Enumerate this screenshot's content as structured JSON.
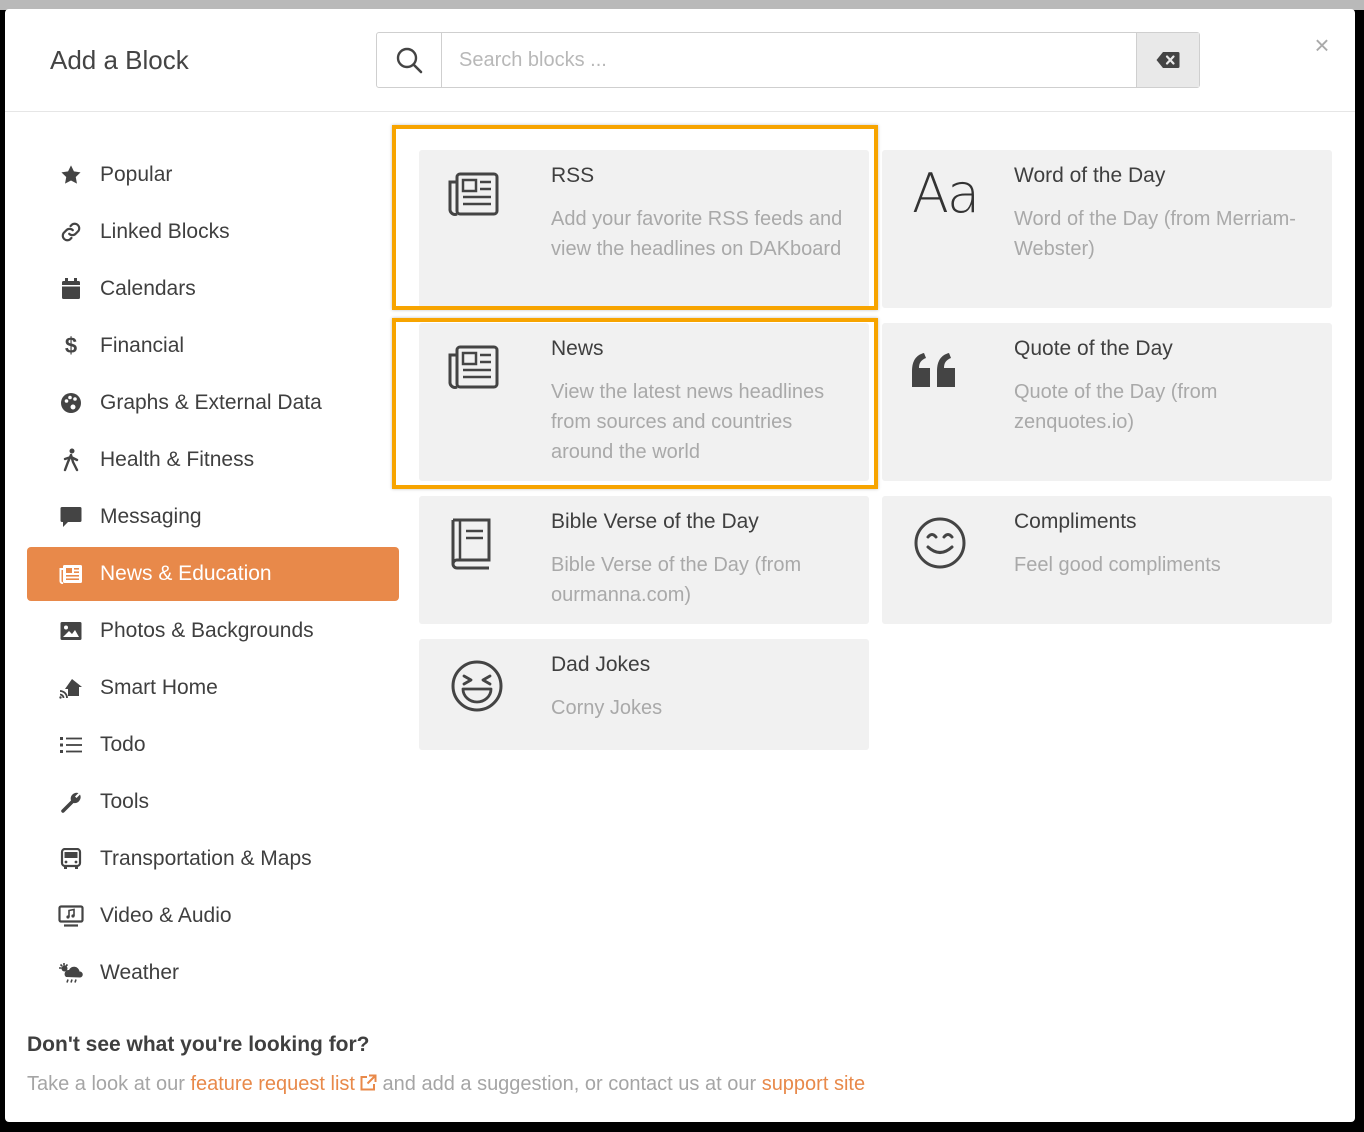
{
  "modal": {
    "title": "Add a Block",
    "search": {
      "placeholder": "Search blocks ...",
      "value": ""
    },
    "close_symbol": "×"
  },
  "categories": [
    {
      "label": "Popular",
      "icon": "star-icon",
      "active": false
    },
    {
      "label": "Linked Blocks",
      "icon": "link-icon",
      "active": false
    },
    {
      "label": "Calendars",
      "icon": "calendar-icon",
      "active": false
    },
    {
      "label": "Financial",
      "icon": "dollar-icon",
      "active": false
    },
    {
      "label": "Graphs & External Data",
      "icon": "palette-icon",
      "active": false
    },
    {
      "label": "Health & Fitness",
      "icon": "walking-icon",
      "active": false
    },
    {
      "label": "Messaging",
      "icon": "message-icon",
      "active": false
    },
    {
      "label": "News & Education",
      "icon": "newspaper-icon",
      "active": true
    },
    {
      "label": "Photos & Backgrounds",
      "icon": "image-icon",
      "active": false
    },
    {
      "label": "Smart Home",
      "icon": "smart-home-icon",
      "active": false
    },
    {
      "label": "Todo",
      "icon": "list-icon",
      "active": false
    },
    {
      "label": "Tools",
      "icon": "wrench-icon",
      "active": false
    },
    {
      "label": "Transportation & Maps",
      "icon": "bus-icon",
      "active": false
    },
    {
      "label": "Video & Audio",
      "icon": "video-icon",
      "active": false
    },
    {
      "label": "Weather",
      "icon": "weather-icon",
      "active": false
    }
  ],
  "blocks": [
    {
      "title": "RSS",
      "description": "Add your favorite RSS feeds and view the headlines on DAKboard",
      "icon": "newspaper-icon",
      "highlighted": true
    },
    {
      "title": "Word of the Day",
      "description": "Word of the Day (from Merriam-Webster)",
      "icon": "font-aa-icon",
      "glyph": "Aa",
      "highlighted": false
    },
    {
      "title": "News",
      "description": "View the latest news headlines from sources and countries around the world",
      "icon": "newspaper-icon",
      "highlighted": true
    },
    {
      "title": "Quote of the Day",
      "description": "Quote of the Day (from zenquotes.io)",
      "icon": "quote-icon",
      "highlighted": false
    },
    {
      "title": "Bible Verse of the Day",
      "description": "Bible Verse of the Day (from ourmanna.com)",
      "icon": "book-icon",
      "highlighted": false
    },
    {
      "title": "Compliments",
      "description": "Feel good compliments",
      "icon": "smile-icon",
      "highlighted": false
    },
    {
      "title": "Dad Jokes",
      "description": "Corny Jokes",
      "icon": "laugh-icon",
      "highlighted": false
    }
  ],
  "footer": {
    "question": "Don't see what you're looking for?",
    "text_before": "Take a look at our",
    "link1": "feature request list",
    "text_middle": "and add a suggestion, or contact us at our",
    "link2": "support site"
  },
  "colors": {
    "accent": "#e8894a",
    "highlight": "#f7a400",
    "card_bg": "#f1f1f1"
  }
}
